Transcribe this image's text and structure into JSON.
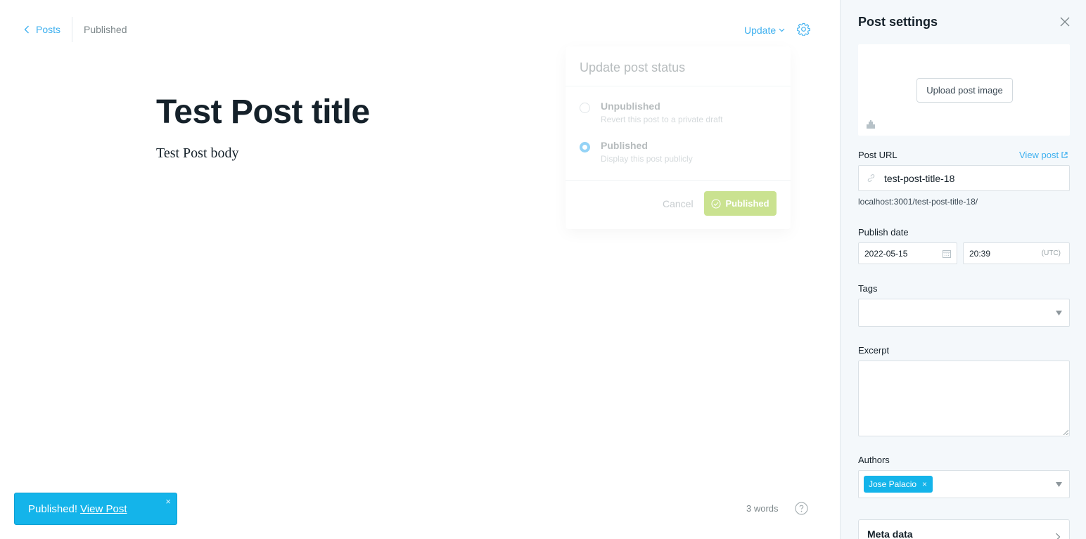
{
  "header": {
    "back_label": "Posts",
    "status": "Published",
    "update_label": "Update"
  },
  "post": {
    "title": "Test Post title",
    "body": "Test Post body"
  },
  "publish_menu": {
    "title": "Update post status",
    "options": [
      {
        "label": "Unpublished",
        "description": "Revert this post to a private draft",
        "selected": false
      },
      {
        "label": "Published",
        "description": "Display this post publicly",
        "selected": true
      }
    ],
    "cancel_label": "Cancel",
    "confirm_label": "Published"
  },
  "footer": {
    "word_count": "3 words"
  },
  "toast": {
    "message": "Published!",
    "link_label": "View Post",
    "close_glyph": "×"
  },
  "settings": {
    "title": "Post settings",
    "upload_label": "Upload post image",
    "post_url_label": "Post URL",
    "view_post_label": "View post",
    "slug_value": "test-post-title-18",
    "url_preview": "localhost:3001/test-post-title-18/",
    "publish_date_label": "Publish date",
    "date_value": "2022-05-15",
    "time_value": "20:39",
    "timezone": "(UTC)",
    "tags_label": "Tags",
    "excerpt_label": "Excerpt",
    "authors_label": "Authors",
    "author_name": "Jose Palacio",
    "author_remove_glyph": "×",
    "meta_data_label": "Meta data"
  },
  "colors": {
    "accent": "#3eb0ef",
    "toast_bg": "#14b4ea",
    "published_green": "#9fcc36",
    "panel_bg": "#f4f8fb",
    "text_dark": "#15212a",
    "text_muted": "#7d878a"
  },
  "icons": [
    "chevron-left-icon",
    "chevron-down-icon",
    "gear-icon",
    "check-circle-icon",
    "help-icon",
    "close-icon",
    "image-icon",
    "external-link-icon",
    "link-icon",
    "calendar-icon",
    "triangle-down-icon",
    "chevron-right-icon"
  ]
}
